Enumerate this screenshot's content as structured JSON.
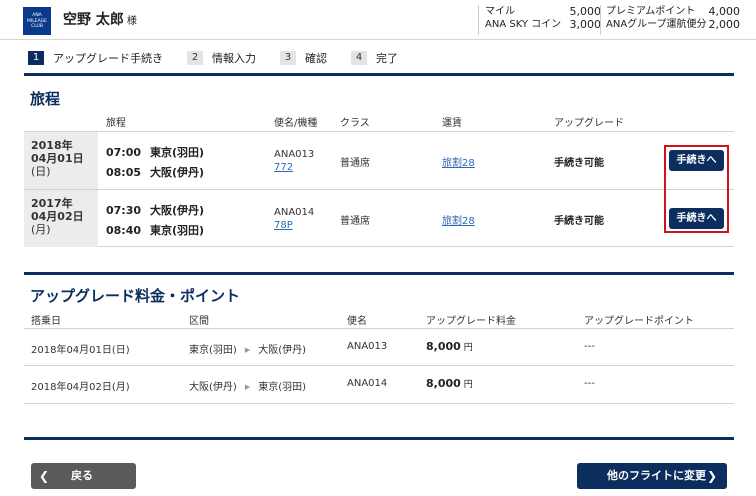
{
  "header": {
    "logo_lines": [
      "ANA",
      "MILEAGE",
      "CLUB"
    ],
    "user_name": "空野 太郎",
    "user_suffix": "様",
    "miles_label": "マイル",
    "miles_value": "5,000",
    "sky_coin_label": "ANA SKY コイン",
    "sky_coin_value": "3,000",
    "premium_points_label": "プレミアムポイント",
    "premium_points_value": "4,000",
    "group_label": "ANAグループ運航便分",
    "group_value": "2,000"
  },
  "steps": [
    {
      "num": "1",
      "label": "アップグレード手続き",
      "active": true
    },
    {
      "num": "2",
      "label": "情報入力",
      "active": false
    },
    {
      "num": "3",
      "label": "確認",
      "active": false
    },
    {
      "num": "4",
      "label": "完了",
      "active": false
    }
  ],
  "itinerary": {
    "title": "旅程",
    "columns": {
      "trip": "旅程",
      "flight": "便名/機種",
      "class": "クラス",
      "fare": "運賃",
      "upgrade": "アップグレード"
    },
    "rows": [
      {
        "year": "2018年",
        "date": "04月01日",
        "dow": "(日)",
        "dep_time": "07:00",
        "dep_airport": "東京(羽田)",
        "arr_time": "08:05",
        "arr_airport": "大阪(伊丹)",
        "flight_no": "ANA013",
        "aircraft": "772",
        "class": "普通席",
        "fare": "旅割28",
        "upgrade_status": "手続き可能",
        "button": "手続きへ"
      },
      {
        "year": "2017年",
        "date": "04月02日",
        "dow": "(月)",
        "dep_time": "07:30",
        "dep_airport": "大阪(伊丹)",
        "arr_time": "08:40",
        "arr_airport": "東京(羽田)",
        "flight_no": "ANA014",
        "aircraft": "78P",
        "class": "普通席",
        "fare": "旅割28",
        "upgrade_status": "手続き可能",
        "button": "手続きへ"
      }
    ]
  },
  "fees": {
    "title": "アップグレード料金・ポイント",
    "columns": {
      "date": "搭乗日",
      "route": "区間",
      "flight": "便名",
      "fee": "アップグレード料金",
      "points": "アップグレードポイント"
    },
    "rows": [
      {
        "date": "2018年04月01日(日)",
        "from": "東京(羽田)",
        "to": "大阪(伊丹)",
        "flight": "ANA013",
        "amount": "8,000",
        "unit": "円",
        "points": "---"
      },
      {
        "date": "2018年04月02日(月)",
        "from": "大阪(伊丹)",
        "to": "東京(羽田)",
        "flight": "ANA014",
        "amount": "8,000",
        "unit": "円",
        "points": "---"
      }
    ]
  },
  "buttons": {
    "back": "戻る",
    "change_flight": "他のフライトに変更"
  },
  "colors": {
    "navy": "#0b2e5e",
    "link_blue": "#2d6ab3",
    "highlight_red": "#d0121b",
    "back_gray": "#5a5a5a"
  },
  "icons": {
    "back": "chevron-left-icon",
    "forward": "chevron-right-icon",
    "route_arrow": "triangle-right-icon"
  }
}
